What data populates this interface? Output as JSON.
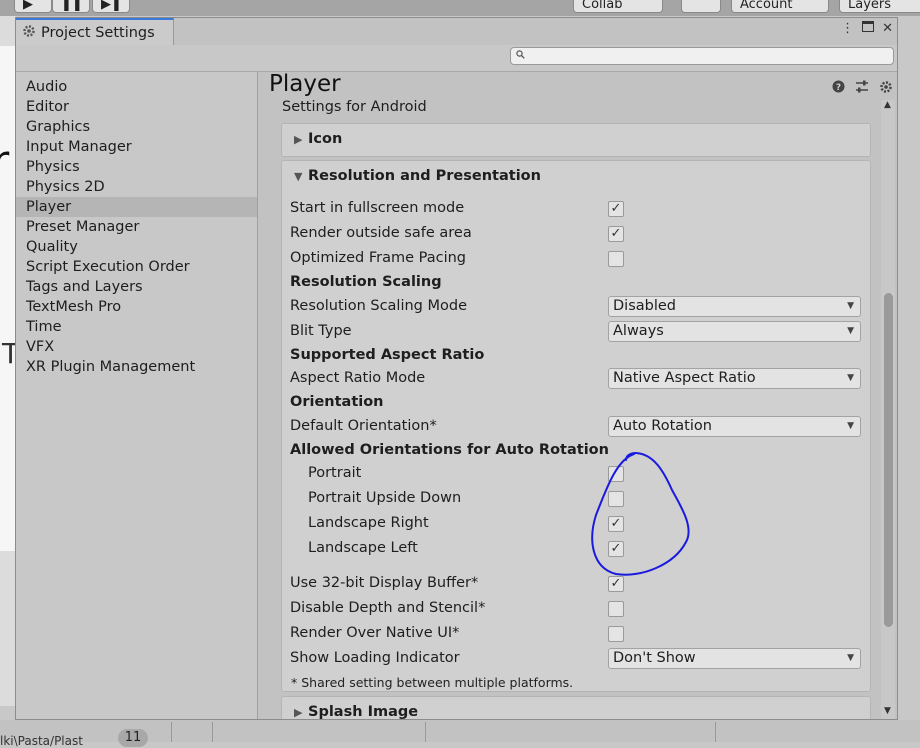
{
  "background": {
    "buttons": [
      "Collab",
      "Account",
      "Layers"
    ],
    "badge": "11",
    "bottom_text": "lki\\Pasta/Plast"
  },
  "window": {
    "tab_title": "Project Settings",
    "search": {
      "placeholder": ""
    }
  },
  "sidebar": {
    "items": [
      {
        "label": "Audio"
      },
      {
        "label": "Editor"
      },
      {
        "label": "Graphics"
      },
      {
        "label": "Input Manager"
      },
      {
        "label": "Physics"
      },
      {
        "label": "Physics 2D"
      },
      {
        "label": "Player",
        "selected": true
      },
      {
        "label": "Preset Manager"
      },
      {
        "label": "Quality"
      },
      {
        "label": "Script Execution Order"
      },
      {
        "label": "Tags and Layers"
      },
      {
        "label": "TextMesh Pro"
      },
      {
        "label": "Time"
      },
      {
        "label": "VFX"
      },
      {
        "label": "XR Plugin Management"
      }
    ]
  },
  "main": {
    "title": "Player",
    "settings_for": "Settings for Android",
    "icon_section": "Icon",
    "resolution_section": "Resolution and Presentation",
    "start_fullscreen": {
      "label": "Start in fullscreen mode",
      "checked": true
    },
    "render_outside_safe": {
      "label": "Render outside safe area",
      "checked": true
    },
    "optimized_frame_pacing": {
      "label": "Optimized Frame Pacing",
      "checked": false
    },
    "resolution_scaling_header": "Resolution Scaling",
    "resolution_scaling_mode": {
      "label": "Resolution Scaling Mode",
      "value": "Disabled"
    },
    "blit_type": {
      "label": "Blit Type",
      "value": "Always"
    },
    "supported_aspect_header": "Supported Aspect Ratio",
    "aspect_ratio_mode": {
      "label": "Aspect Ratio Mode",
      "value": "Native Aspect Ratio"
    },
    "orientation_header": "Orientation",
    "default_orientation": {
      "label": "Default Orientation*",
      "value": "Auto Rotation"
    },
    "allowed_header": "Allowed Orientations for Auto Rotation",
    "portrait": {
      "label": "Portrait",
      "checked": false
    },
    "portrait_upside_down": {
      "label": "Portrait Upside Down",
      "checked": false
    },
    "landscape_right": {
      "label": "Landscape Right",
      "checked": true
    },
    "landscape_left": {
      "label": "Landscape Left",
      "checked": true
    },
    "use_32bit": {
      "label": "Use 32-bit Display Buffer*",
      "checked": true
    },
    "disable_depth": {
      "label": "Disable Depth and Stencil*",
      "checked": false
    },
    "render_over_native": {
      "label": "Render Over Native UI*",
      "checked": false
    },
    "loading_indicator": {
      "label": "Show Loading Indicator",
      "value": "Don't Show"
    },
    "shared_note": "* Shared setting between multiple platforms.",
    "splash_section": "Splash Image"
  },
  "colors": {
    "annotation": "#1a1adf",
    "tab_accent": "#3a79d8"
  }
}
